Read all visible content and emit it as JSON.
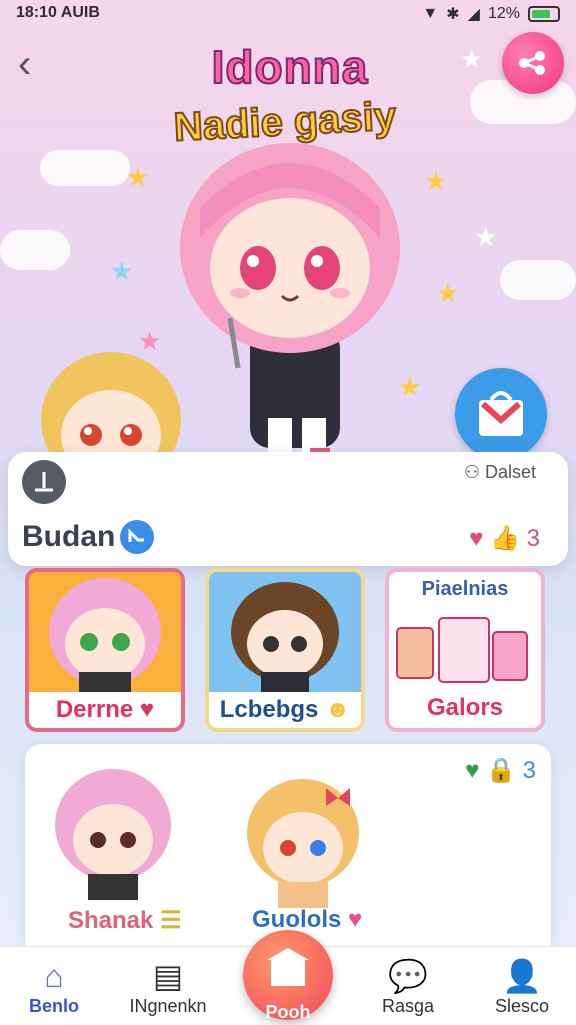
{
  "status_bar": {
    "time": "18:10 AUIB",
    "battery": "12%"
  },
  "title": {
    "line1": "Idonna",
    "line2": "Nadie gasiy"
  },
  "profile_card": {
    "download_label": "",
    "dataset_label": "Dalset",
    "name": "Budan",
    "count": "3"
  },
  "tiles": [
    {
      "label": "Derrne"
    },
    {
      "label": "Lcbebgs"
    },
    {
      "label": "Galors",
      "header": "Piaelnias"
    }
  ],
  "characters_card": {
    "count": "3",
    "characters": [
      {
        "name": "Shanak"
      },
      {
        "name": "Guolols"
      }
    ]
  },
  "nav": {
    "items": [
      {
        "label": "Benlo",
        "icon": "home-icon"
      },
      {
        "label": "INgnenkn",
        "icon": "clipboard-icon"
      },
      {
        "label": "Pooh",
        "icon": "store-icon"
      },
      {
        "label": "Rasga",
        "icon": "chat-icon"
      },
      {
        "label": "Slesco",
        "icon": "user-icon"
      }
    ]
  },
  "colors": {
    "accent": "#f0357a",
    "blue": "#3a9be8"
  }
}
